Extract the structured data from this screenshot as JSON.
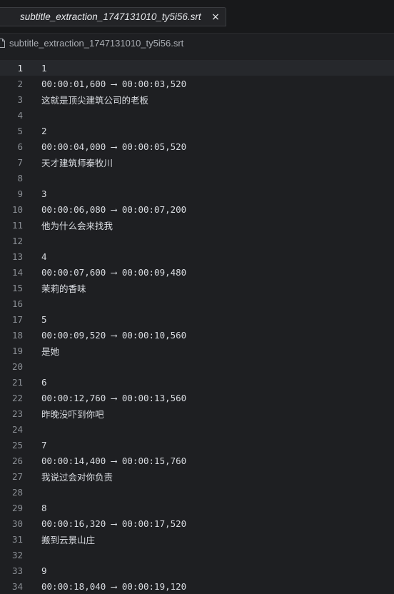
{
  "tab": {
    "title": "subtitle_extraction_1747131010_ty5i56.srt",
    "close_icon": "×"
  },
  "breadcrumb": {
    "file": "subtitle_extraction_1747131010_ty5i56.srt"
  },
  "editor": {
    "current_line": 1,
    "lines": [
      {
        "num": "1",
        "text": "1"
      },
      {
        "num": "2",
        "text": "00:00:01,600 ⟶ 00:00:03,520"
      },
      {
        "num": "3",
        "text": "这就是顶尖建筑公司的老板"
      },
      {
        "num": "4",
        "text": ""
      },
      {
        "num": "5",
        "text": "2"
      },
      {
        "num": "6",
        "text": "00:00:04,000 ⟶ 00:00:05,520"
      },
      {
        "num": "7",
        "text": "天才建筑师秦牧川"
      },
      {
        "num": "8",
        "text": ""
      },
      {
        "num": "9",
        "text": "3"
      },
      {
        "num": "10",
        "text": "00:00:06,080 ⟶ 00:00:07,200"
      },
      {
        "num": "11",
        "text": "他为什么会来找我"
      },
      {
        "num": "12",
        "text": ""
      },
      {
        "num": "13",
        "text": "4"
      },
      {
        "num": "14",
        "text": "00:00:07,600 ⟶ 00:00:09,480"
      },
      {
        "num": "15",
        "text": "茉莉的香味"
      },
      {
        "num": "16",
        "text": ""
      },
      {
        "num": "17",
        "text": "5"
      },
      {
        "num": "18",
        "text": "00:00:09,520 ⟶ 00:00:10,560"
      },
      {
        "num": "19",
        "text": "是她"
      },
      {
        "num": "20",
        "text": ""
      },
      {
        "num": "21",
        "text": "6"
      },
      {
        "num": "22",
        "text": "00:00:12,760 ⟶ 00:00:13,560"
      },
      {
        "num": "23",
        "text": "昨晚没吓到你吧"
      },
      {
        "num": "24",
        "text": ""
      },
      {
        "num": "25",
        "text": "7"
      },
      {
        "num": "26",
        "text": "00:00:14,400 ⟶ 00:00:15,760"
      },
      {
        "num": "27",
        "text": "我说过会对你负责"
      },
      {
        "num": "28",
        "text": ""
      },
      {
        "num": "29",
        "text": "8"
      },
      {
        "num": "30",
        "text": "00:00:16,320 ⟶ 00:00:17,520"
      },
      {
        "num": "31",
        "text": "搬到云景山庄"
      },
      {
        "num": "32",
        "text": ""
      },
      {
        "num": "33",
        "text": "9"
      },
      {
        "num": "34",
        "text": "00:00:18,040 ⟶ 00:00:19,120"
      }
    ]
  }
}
